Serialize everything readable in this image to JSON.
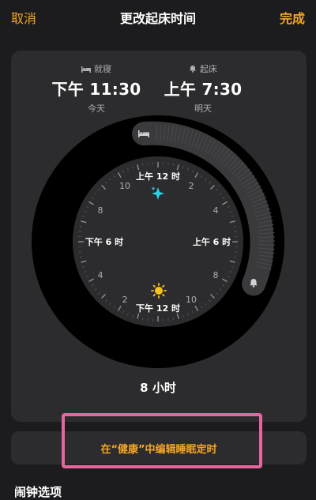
{
  "nav": {
    "cancel": "取消",
    "title": "更改起床时间",
    "done": "完成"
  },
  "bedtime": {
    "label": "就寝",
    "time": "下午 11:30",
    "day": "今天",
    "icon": "bed-icon"
  },
  "wakeup": {
    "label": "起床",
    "time": "上午 7:30",
    "day": "明天",
    "icon": "bell-icon"
  },
  "clock": {
    "top": "上午 12 时",
    "right": "上午 6 时",
    "bottom": "下午 12 时",
    "left": "下午 6 时",
    "numbers": [
      "2",
      "4",
      "8",
      "10",
      "2",
      "4",
      "8",
      "10"
    ]
  },
  "duration": "8 小时",
  "health_button": "在“健康”中编辑睡眠定时",
  "bottom_partial": "闹钟选项",
  "colors": {
    "accent": "#f5a623",
    "highlight": "#e7659f",
    "sparkle": "#2ad1e6",
    "sun": "#f7c21b"
  }
}
